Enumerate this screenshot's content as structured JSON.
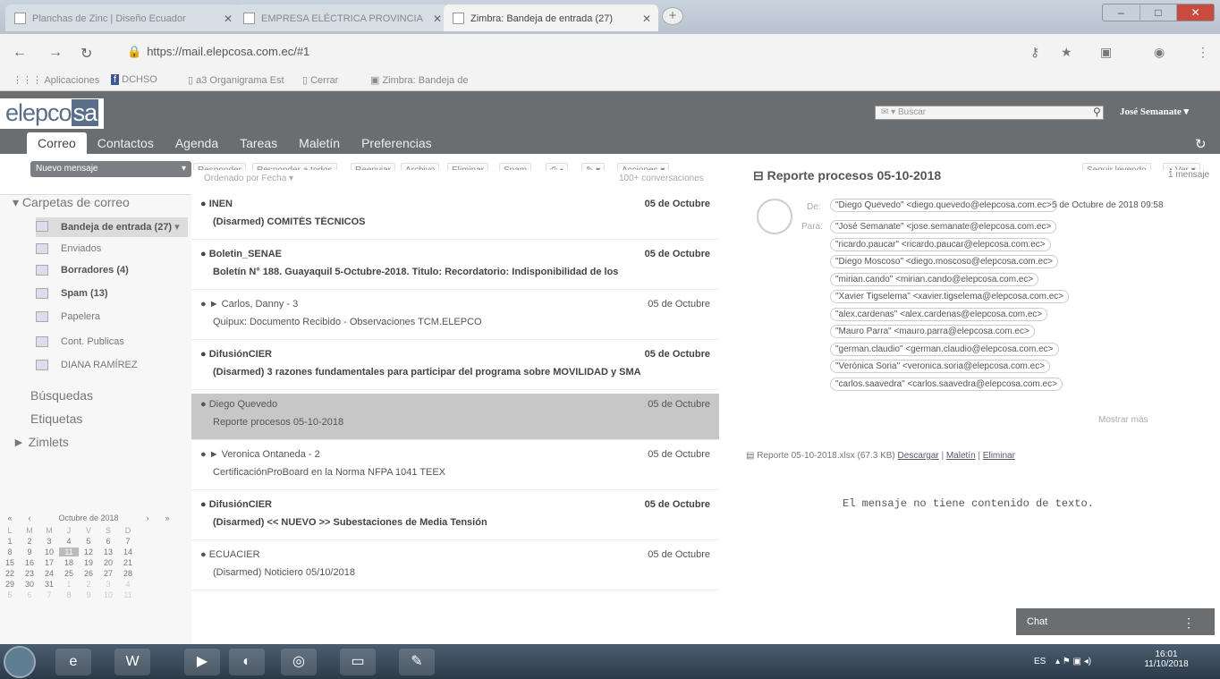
{
  "browser": {
    "tabs": [
      {
        "label": "Planchas de Zinc | Diseño Ecuador"
      },
      {
        "label": "EMPRESA ELÉCTRICA PROVINCIA"
      },
      {
        "label": "Zimbra: Bandeja de entrada (27)"
      }
    ],
    "url": "https://mail.elepcosa.com.ec/#1",
    "bookmarks": [
      "Aplicaciones",
      "DCHSO",
      "a3 Organigrama Est",
      "Cerrar",
      "Zimbra: Bandeja de"
    ]
  },
  "header": {
    "logo": "elepco",
    "logo_suffix": "sa",
    "search_placeholder": "Buscar",
    "user": "José Semanate"
  },
  "apptabs": [
    "Correo",
    "Contactos",
    "Agenda",
    "Tareas",
    "Maletín",
    "Preferencias"
  ],
  "toolbar": {
    "new_message": "Nuevo mensaje",
    "actions": [
      "Responder",
      "Responder a todos",
      "Reenviar",
      "Archivo",
      "Eliminar",
      "Spam"
    ],
    "acciones": "Acciones",
    "seguir": "Seguir leyendo",
    "ver": "Ver"
  },
  "sidebar": {
    "mail_folders": "Carpetas de correo",
    "folders": [
      {
        "label": "Bandeja de entrada (27)",
        "bold": true
      },
      {
        "label": "Enviados"
      },
      {
        "label": "Borradores (4)",
        "bold": true
      },
      {
        "label": "Spam (13)",
        "bold": true
      },
      {
        "label": "Papelera"
      },
      {
        "label": "Cont. Publicas"
      },
      {
        "label": "DIANA RAMÍREZ"
      }
    ],
    "searches": "Búsquedas",
    "tags": "Etiquetas",
    "zimlets": "Zimlets"
  },
  "calendar": {
    "title": "Octubre de 2018",
    "weekdays": [
      "L",
      "M",
      "M",
      "J",
      "V",
      "S",
      "D"
    ],
    "weeks": [
      [
        "1",
        "2",
        "3",
        "4",
        "5",
        "6",
        "7"
      ],
      [
        "8",
        "9",
        "10",
        "11",
        "12",
        "13",
        "14"
      ],
      [
        "15",
        "16",
        "17",
        "18",
        "19",
        "20",
        "21"
      ],
      [
        "22",
        "23",
        "24",
        "25",
        "26",
        "27",
        "28"
      ],
      [
        "29",
        "30",
        "31",
        "1",
        "2",
        "3",
        "4"
      ],
      [
        "5",
        "6",
        "7",
        "8",
        "9",
        "10",
        "11"
      ]
    ]
  },
  "list": {
    "sorted": "Ordenado por Fecha",
    "count": "100+ conversaciones",
    "messages": [
      {
        "from": "INEN",
        "date": "05 de Octubre",
        "subject": "(Disarmed) COMITÉS TÉCNICOS",
        "unread": true
      },
      {
        "from": "Boletin_SENAE",
        "date": "05 de Octubre",
        "subject": "Boletín N° 188. Guayaquil 5-Octubre-2018. Titulo: Recordatorio: Indisponibilidad de los",
        "unread": true
      },
      {
        "from": "► Carlos, Danny - 3",
        "date": "05 de Octubre",
        "subject": "Quipux: Documento Recibido - Observaciones TCM.ELEPCO",
        "unread": false
      },
      {
        "from": "DifusiónCIER",
        "date": "05 de Octubre",
        "subject": "(Disarmed) 3 razones fundamentales para participar del programa sobre MOVILIDAD y SMA",
        "unread": true
      },
      {
        "from": "Diego Quevedo",
        "date": "05 de Octubre",
        "subject": "Reporte procesos 05-10-2018",
        "unread": false,
        "selected": true
      },
      {
        "from": "► Veronica Ontaneda - 2",
        "date": "05 de Octubre",
        "subject": "CertificaciónProBoard en la Norma NFPA 1041 TEEX",
        "unread": false
      },
      {
        "from": "DifusiónCIER",
        "date": "05 de Octubre",
        "subject": "(Disarmed) << NUEVO >> Subestaciones de Media Tensión",
        "unread": true
      },
      {
        "from": "ECUACIER",
        "date": "05 de Octubre",
        "subject": "(Disarmed) Noticiero 05/10/2018",
        "unread": false
      }
    ]
  },
  "reading": {
    "title": "Reporte procesos 05-10-2018",
    "count": "1 mensaje",
    "de_label": "De:",
    "para_label": "Para:",
    "from": "\"Diego Quevedo\" <diego.quevedo@elepcosa.com.ec>",
    "date": "5 de Octubre de 2018 09:58",
    "to": [
      "\"José Semanate\" <jose.semanate@elepcosa.com.ec>",
      "\"ricardo.paucar\" <ricardo.paucar@elepcosa.com.ec>",
      "\"Diego Moscoso\" <diego.moscoso@elepcosa.com.ec>",
      "\"mirian.cando\" <mirian.cando@elepcosa.com.ec>",
      "\"Xavier Tigselema\" <xavier.tigselema@elepcosa.com.ec>",
      "\"alex.cardenas\" <alex.cardenas@elepcosa.com.ec>",
      "\"Mauro Parra\" <mauro.parra@elepcosa.com.ec>",
      "\"german.claudio\" <german.claudio@elepcosa.com.ec>",
      "\"Verónica Soria\" <veronica.soria@elepcosa.com.ec>",
      "\"carlos.saavedra\" <carlos.saavedra@elepcosa.com.ec>"
    ],
    "show_more": "Mostrar más",
    "attachment": "Reporte 05-10-2018.xlsx (67.3 KB)",
    "download": "Descargar",
    "maletin": "Maletín",
    "delete": "Eliminar",
    "no_content": "El mensaje no tiene contenido de texto."
  },
  "chat": "Chat",
  "taskbar": {
    "lang": "ES",
    "time": "16:01",
    "date": "11/10/2018"
  }
}
